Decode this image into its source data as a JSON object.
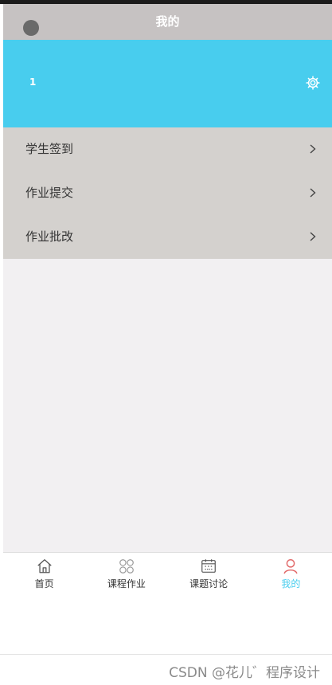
{
  "header": {
    "title": "我的"
  },
  "profile": {
    "username": "1"
  },
  "menu": {
    "items": [
      {
        "label": "学生签到"
      },
      {
        "label": "作业提交"
      },
      {
        "label": "作业批改"
      }
    ]
  },
  "tabbar": {
    "tabs": [
      {
        "label": "首页",
        "icon": "home-icon"
      },
      {
        "label": "课程作业",
        "icon": "grid-icon"
      },
      {
        "label": "课题讨论",
        "icon": "calendar-icon"
      },
      {
        "label": "我的",
        "icon": "user-icon"
      }
    ],
    "active_index": 3
  },
  "watermark": {
    "text": "CSDN @花儿゛程序设计"
  },
  "colors": {
    "accent": "#48cdee",
    "navbar": "#c6c2c2",
    "menu_bg": "#d4d1ce",
    "page_bg": "#f2f0f2",
    "active_icon": "#e26a6a"
  }
}
